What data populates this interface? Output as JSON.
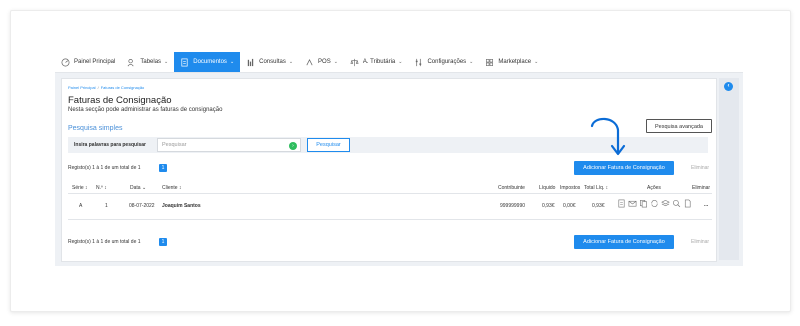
{
  "nav": {
    "items": [
      {
        "label": "Painel Principal",
        "icon": "dashboard-icon",
        "chevron": ""
      },
      {
        "label": "Tabelas",
        "icon": "users-icon",
        "chevron": "⌄"
      },
      {
        "label": "Documentos",
        "icon": "document-icon",
        "chevron": "⌄",
        "active": true
      },
      {
        "label": "Consultas",
        "icon": "chat-icon",
        "chevron": "⌄"
      },
      {
        "label": "POS",
        "icon": "pos-icon",
        "chevron": "⌄"
      },
      {
        "label": "A. Tributária",
        "icon": "balance-icon",
        "chevron": "⌄"
      },
      {
        "label": "Configurações",
        "icon": "sliders-icon",
        "chevron": "⌄"
      },
      {
        "label": "Marketplace",
        "icon": "grid-icon",
        "chevron": "⌄"
      }
    ]
  },
  "breadcrumb": {
    "home": "Painel Principal",
    "sep": "/",
    "current": "Faturas de Consignação"
  },
  "page": {
    "title": "Faturas de Consignação",
    "subtitle": "Nesta secção pode administrar as faturas de consignação"
  },
  "search": {
    "section_title": "Pesquisa simples",
    "advanced_label": "Pesquisa avançada",
    "label": "Insira palavras para pesquisar",
    "placeholder": "Pesquisar",
    "button": "Pesquisar"
  },
  "records": {
    "text": "Registo(s) 1 à 1 de um total de 1",
    "page": "1"
  },
  "toolbar": {
    "add_label": "Adicionar Fatura de Consignação",
    "delete_label": "Eliminar"
  },
  "table": {
    "headers": {
      "serie": "Série ↕",
      "num": "N.º ↕",
      "date": "Data ⌄",
      "client": "Cliente ↕",
      "nif": "Contribuinte",
      "net": "Líquido",
      "tax": "Impostos",
      "total": "Total Líq. ↕",
      "actions": "Ações",
      "delete": "Eliminar"
    },
    "rows": [
      {
        "serie": "A",
        "num": "1",
        "date": "08-07-2022",
        "client": "Joaquim Santos",
        "nif": "999999990",
        "net": "0,93€",
        "tax": "0,00€",
        "total": "0,93€",
        "more": "..."
      }
    ]
  },
  "colors": {
    "accent": "#1f8bed",
    "success": "#2ebd5e",
    "arrow": "#0b6cd6"
  }
}
